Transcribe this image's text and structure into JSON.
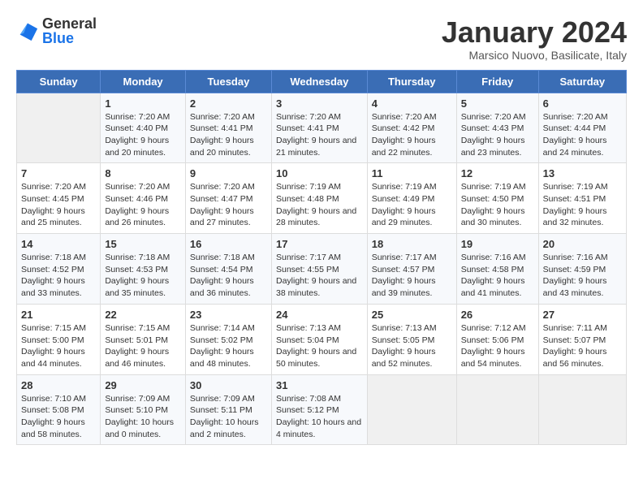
{
  "logo": {
    "general": "General",
    "blue": "Blue"
  },
  "title": "January 2024",
  "subtitle": "Marsico Nuovo, Basilicate, Italy",
  "days_of_week": [
    "Sunday",
    "Monday",
    "Tuesday",
    "Wednesday",
    "Thursday",
    "Friday",
    "Saturday"
  ],
  "weeks": [
    [
      {
        "num": "",
        "sunrise": "",
        "sunset": "",
        "daylight": ""
      },
      {
        "num": "1",
        "sunrise": "Sunrise: 7:20 AM",
        "sunset": "Sunset: 4:40 PM",
        "daylight": "Daylight: 9 hours and 20 minutes."
      },
      {
        "num": "2",
        "sunrise": "Sunrise: 7:20 AM",
        "sunset": "Sunset: 4:41 PM",
        "daylight": "Daylight: 9 hours and 20 minutes."
      },
      {
        "num": "3",
        "sunrise": "Sunrise: 7:20 AM",
        "sunset": "Sunset: 4:41 PM",
        "daylight": "Daylight: 9 hours and 21 minutes."
      },
      {
        "num": "4",
        "sunrise": "Sunrise: 7:20 AM",
        "sunset": "Sunset: 4:42 PM",
        "daylight": "Daylight: 9 hours and 22 minutes."
      },
      {
        "num": "5",
        "sunrise": "Sunrise: 7:20 AM",
        "sunset": "Sunset: 4:43 PM",
        "daylight": "Daylight: 9 hours and 23 minutes."
      },
      {
        "num": "6",
        "sunrise": "Sunrise: 7:20 AM",
        "sunset": "Sunset: 4:44 PM",
        "daylight": "Daylight: 9 hours and 24 minutes."
      }
    ],
    [
      {
        "num": "7",
        "sunrise": "Sunrise: 7:20 AM",
        "sunset": "Sunset: 4:45 PM",
        "daylight": "Daylight: 9 hours and 25 minutes."
      },
      {
        "num": "8",
        "sunrise": "Sunrise: 7:20 AM",
        "sunset": "Sunset: 4:46 PM",
        "daylight": "Daylight: 9 hours and 26 minutes."
      },
      {
        "num": "9",
        "sunrise": "Sunrise: 7:20 AM",
        "sunset": "Sunset: 4:47 PM",
        "daylight": "Daylight: 9 hours and 27 minutes."
      },
      {
        "num": "10",
        "sunrise": "Sunrise: 7:19 AM",
        "sunset": "Sunset: 4:48 PM",
        "daylight": "Daylight: 9 hours and 28 minutes."
      },
      {
        "num": "11",
        "sunrise": "Sunrise: 7:19 AM",
        "sunset": "Sunset: 4:49 PM",
        "daylight": "Daylight: 9 hours and 29 minutes."
      },
      {
        "num": "12",
        "sunrise": "Sunrise: 7:19 AM",
        "sunset": "Sunset: 4:50 PM",
        "daylight": "Daylight: 9 hours and 30 minutes."
      },
      {
        "num": "13",
        "sunrise": "Sunrise: 7:19 AM",
        "sunset": "Sunset: 4:51 PM",
        "daylight": "Daylight: 9 hours and 32 minutes."
      }
    ],
    [
      {
        "num": "14",
        "sunrise": "Sunrise: 7:18 AM",
        "sunset": "Sunset: 4:52 PM",
        "daylight": "Daylight: 9 hours and 33 minutes."
      },
      {
        "num": "15",
        "sunrise": "Sunrise: 7:18 AM",
        "sunset": "Sunset: 4:53 PM",
        "daylight": "Daylight: 9 hours and 35 minutes."
      },
      {
        "num": "16",
        "sunrise": "Sunrise: 7:18 AM",
        "sunset": "Sunset: 4:54 PM",
        "daylight": "Daylight: 9 hours and 36 minutes."
      },
      {
        "num": "17",
        "sunrise": "Sunrise: 7:17 AM",
        "sunset": "Sunset: 4:55 PM",
        "daylight": "Daylight: 9 hours and 38 minutes."
      },
      {
        "num": "18",
        "sunrise": "Sunrise: 7:17 AM",
        "sunset": "Sunset: 4:57 PM",
        "daylight": "Daylight: 9 hours and 39 minutes."
      },
      {
        "num": "19",
        "sunrise": "Sunrise: 7:16 AM",
        "sunset": "Sunset: 4:58 PM",
        "daylight": "Daylight: 9 hours and 41 minutes."
      },
      {
        "num": "20",
        "sunrise": "Sunrise: 7:16 AM",
        "sunset": "Sunset: 4:59 PM",
        "daylight": "Daylight: 9 hours and 43 minutes."
      }
    ],
    [
      {
        "num": "21",
        "sunrise": "Sunrise: 7:15 AM",
        "sunset": "Sunset: 5:00 PM",
        "daylight": "Daylight: 9 hours and 44 minutes."
      },
      {
        "num": "22",
        "sunrise": "Sunrise: 7:15 AM",
        "sunset": "Sunset: 5:01 PM",
        "daylight": "Daylight: 9 hours and 46 minutes."
      },
      {
        "num": "23",
        "sunrise": "Sunrise: 7:14 AM",
        "sunset": "Sunset: 5:02 PM",
        "daylight": "Daylight: 9 hours and 48 minutes."
      },
      {
        "num": "24",
        "sunrise": "Sunrise: 7:13 AM",
        "sunset": "Sunset: 5:04 PM",
        "daylight": "Daylight: 9 hours and 50 minutes."
      },
      {
        "num": "25",
        "sunrise": "Sunrise: 7:13 AM",
        "sunset": "Sunset: 5:05 PM",
        "daylight": "Daylight: 9 hours and 52 minutes."
      },
      {
        "num": "26",
        "sunrise": "Sunrise: 7:12 AM",
        "sunset": "Sunset: 5:06 PM",
        "daylight": "Daylight: 9 hours and 54 minutes."
      },
      {
        "num": "27",
        "sunrise": "Sunrise: 7:11 AM",
        "sunset": "Sunset: 5:07 PM",
        "daylight": "Daylight: 9 hours and 56 minutes."
      }
    ],
    [
      {
        "num": "28",
        "sunrise": "Sunrise: 7:10 AM",
        "sunset": "Sunset: 5:08 PM",
        "daylight": "Daylight: 9 hours and 58 minutes."
      },
      {
        "num": "29",
        "sunrise": "Sunrise: 7:09 AM",
        "sunset": "Sunset: 5:10 PM",
        "daylight": "Daylight: 10 hours and 0 minutes."
      },
      {
        "num": "30",
        "sunrise": "Sunrise: 7:09 AM",
        "sunset": "Sunset: 5:11 PM",
        "daylight": "Daylight: 10 hours and 2 minutes."
      },
      {
        "num": "31",
        "sunrise": "Sunrise: 7:08 AM",
        "sunset": "Sunset: 5:12 PM",
        "daylight": "Daylight: 10 hours and 4 minutes."
      },
      {
        "num": "",
        "sunrise": "",
        "sunset": "",
        "daylight": ""
      },
      {
        "num": "",
        "sunrise": "",
        "sunset": "",
        "daylight": ""
      },
      {
        "num": "",
        "sunrise": "",
        "sunset": "",
        "daylight": ""
      }
    ]
  ]
}
